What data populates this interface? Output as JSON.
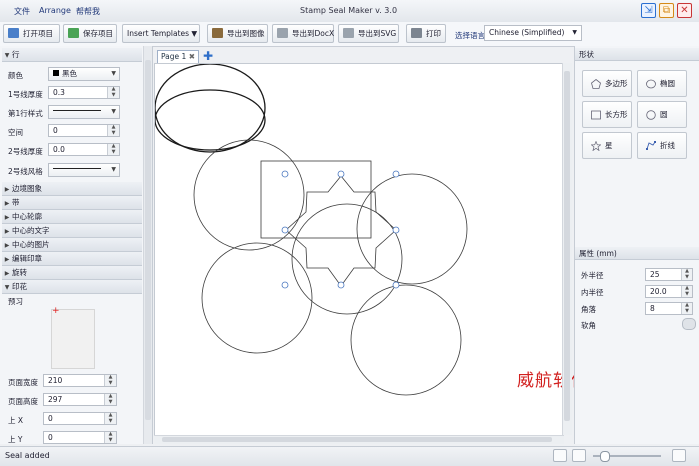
{
  "titlebar": {
    "app_title": "Stamp Seal Maker v. 3.0",
    "menu": [
      "文件",
      "Arrange",
      "帮帮我"
    ]
  },
  "toolbar": {
    "open_project": "打开项目",
    "save_project": "保存项目",
    "insert_templates": "Insert Templates",
    "export_image": "导出到图像",
    "export_docx": "导出到DocX",
    "export_svg": "导出到SVG",
    "print": "打印",
    "language_label": "选择语言",
    "language_value": "Chinese (Simplified)"
  },
  "left_panel": {
    "line_section": "行",
    "color_label": "颜色",
    "color_value": "黑色",
    "line1_thickness_label": "1号线厚度",
    "line1_thickness_value": "0.3",
    "line1_style_label": "第1行样式",
    "space_label": "空间",
    "space_value": "0",
    "line2_thickness_label": "2号线厚度",
    "line2_thickness_value": "0.0",
    "line2_style_label": "2号线风格",
    "sections": [
      "边境图象",
      "带",
      "中心轮廓",
      "中心的文字",
      "中心的图片",
      "编辑印章",
      "旋转"
    ],
    "print_section": "印花",
    "preview_label": "预习",
    "page_width_label": "页面宽度",
    "page_width_value": "210",
    "page_height_label": "页面高度",
    "page_height_value": "297",
    "top_x_label": "上 X",
    "top_x_value": "0",
    "top_y_label": "上 Y",
    "top_y_value": "0"
  },
  "canvas": {
    "tab_label": "Page 1",
    "watermark": "威航软件园"
  },
  "right_panel": {
    "shapes_header": "形状",
    "shapes": [
      "多边形",
      "椭圆",
      "长方形",
      "圆",
      "星",
      "折线"
    ],
    "properties_header": "属性 (mm)",
    "outer_radius_label": "外半径",
    "outer_radius_value": "25",
    "inner_radius_label": "内半径",
    "inner_radius_value": "20.0",
    "corners_label": "角落",
    "corners_value": "8",
    "smooth_label": "软角"
  },
  "statusbar": {
    "text": "Seal added"
  },
  "colors": {
    "accent_blue": "#1f5fd1",
    "watermark_red": "#d2201f",
    "close_red": "#d63a3a"
  }
}
